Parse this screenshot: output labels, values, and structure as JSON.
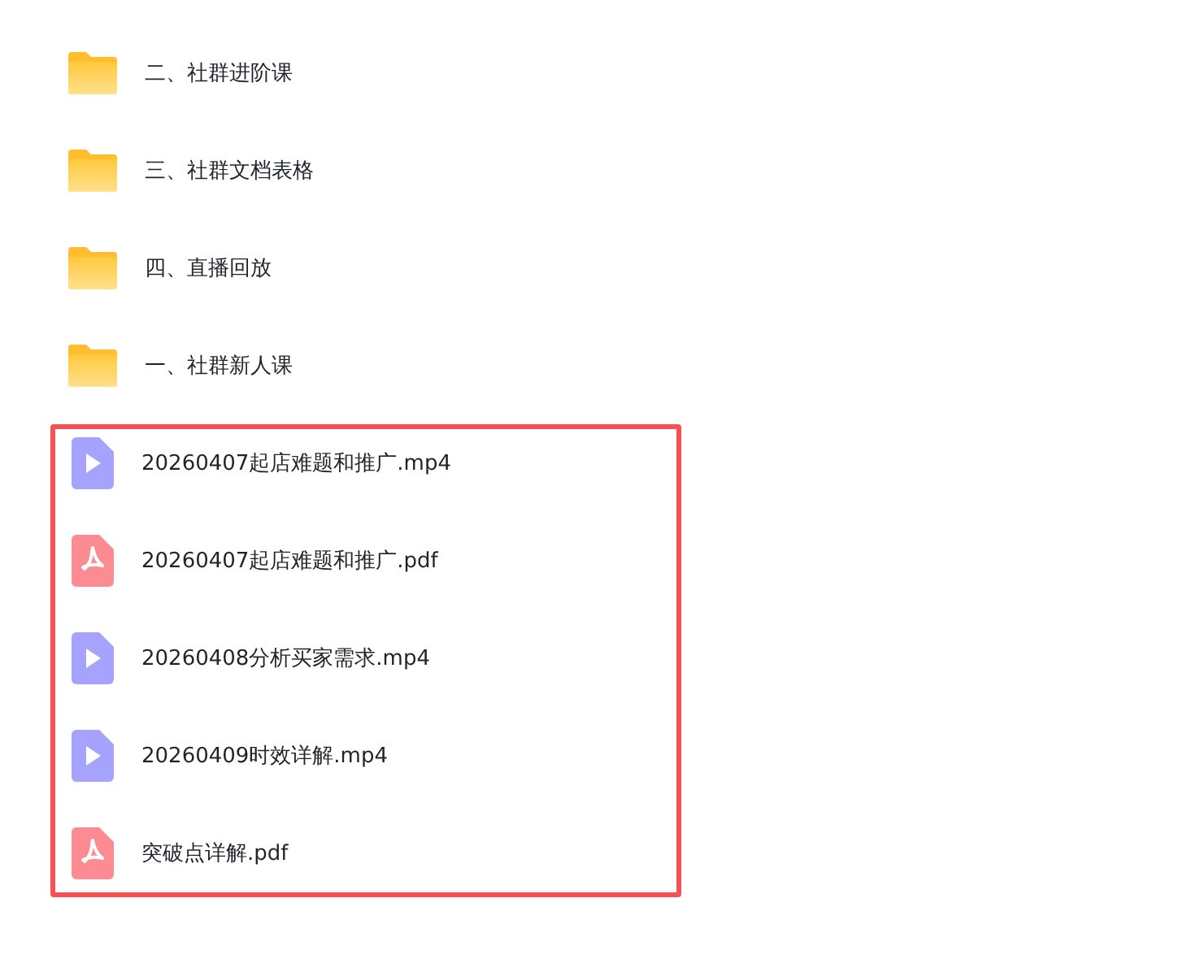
{
  "folders": [
    {
      "name": "二、社群进阶课"
    },
    {
      "name": "三、社群文档表格"
    },
    {
      "name": "四、直播回放"
    },
    {
      "name": "一、社群新人课"
    }
  ],
  "highlighted_files": {
    "highlighted": true,
    "files": [
      {
        "kind": "video",
        "name": "20260407起店难题和推广.mp4"
      },
      {
        "kind": "pdf",
        "name": "20260407起店难题和推广.pdf"
      },
      {
        "kind": "video",
        "name": "20260408分析买家需求.mp4"
      },
      {
        "kind": "video",
        "name": "20260409时效详解.mp4"
      },
      {
        "kind": "pdf",
        "name": "突破点详解.pdf"
      }
    ]
  }
}
